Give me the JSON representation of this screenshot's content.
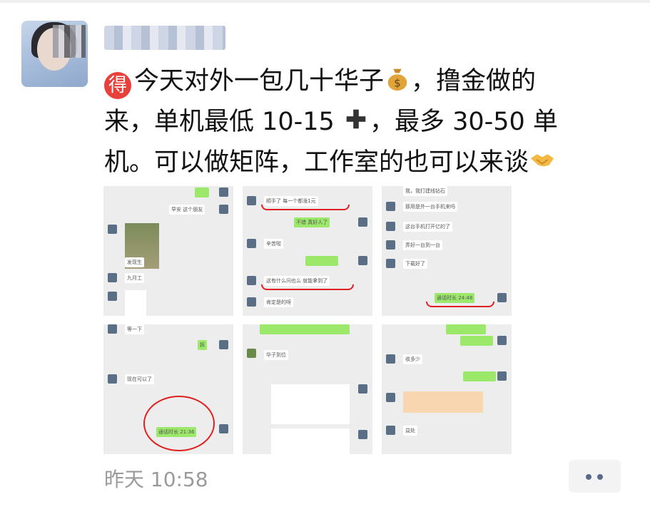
{
  "post": {
    "text_line1": "今天对外一包几十华子",
    "text_line1b": "，撸金做的",
    "text_line2a": "来，单机最低 10-15",
    "text_line2b": "，最多 30-50 单",
    "text_line3": "机。可以做矩阵，工作室的也可以来谈",
    "badge_char": "得",
    "timestamp": "昨天 10:58"
  },
  "thumbs": {
    "t1": [
      "早安 这个朋友",
      "发现生",
      "九月工"
    ],
    "t2": [
      "顺手了 每一个都涨1元",
      "不错 真好人了",
      "辛苦啦",
      "这有什么问也么 就能拿到了",
      "肯定是的呀"
    ],
    "t3": [
      "我，我打建线钻石",
      "那用是外一台手机来吗",
      "这台手机打开亿的了",
      "弄好一台到一台",
      "下载好了",
      "通话时长 24:48"
    ],
    "t4": [
      "等一下",
      "拆",
      "现在可以了",
      "通话时长 21:36"
    ],
    "t5": [
      "华子到位"
    ],
    "t6": [
      "收多少",
      "益处"
    ]
  },
  "colors": {
    "bubble_green": "#9be86a",
    "thumb_bg": "#ededed",
    "badge_red": "#e8403a",
    "timestamp_gray": "#9a9a9a"
  }
}
